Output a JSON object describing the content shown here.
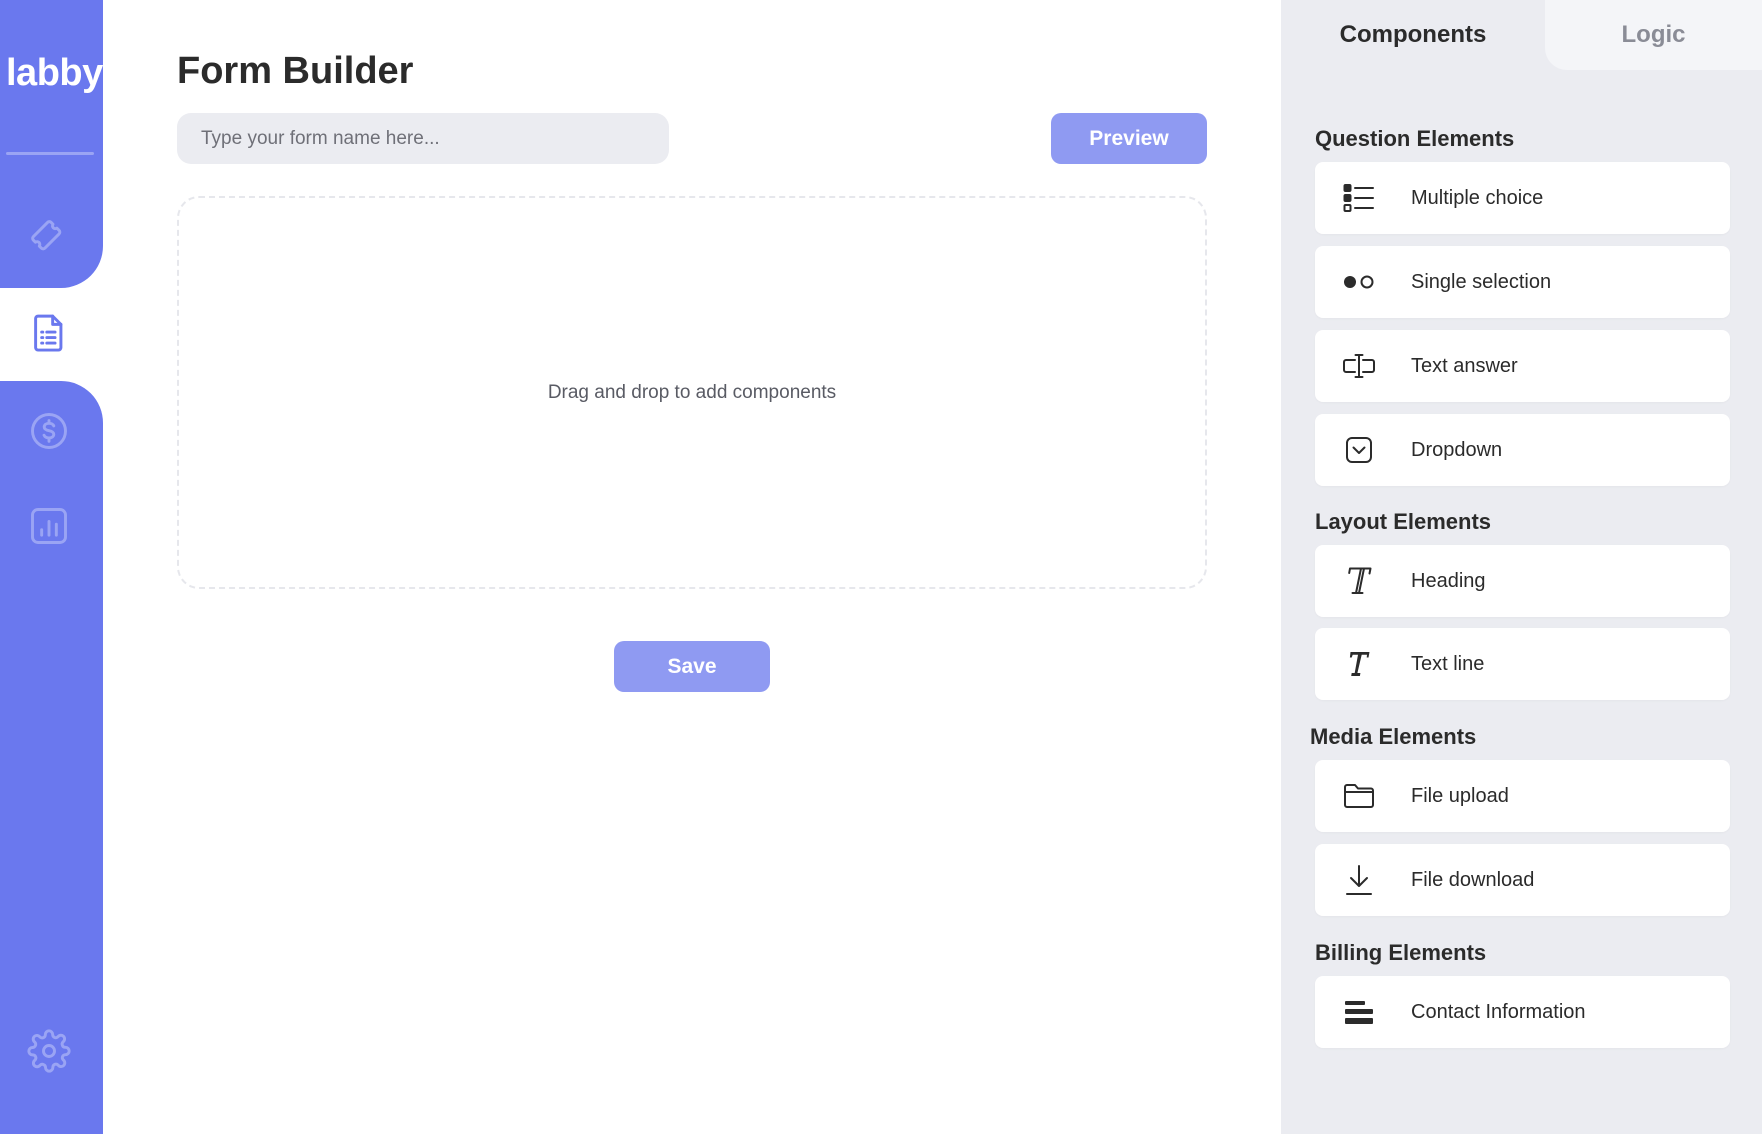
{
  "brand": {
    "logo_text": "labby",
    "accent": "#6a78ee",
    "button": "#8f9af2"
  },
  "sidebar": {
    "items": [
      {
        "name": "tag-icon",
        "active": false
      },
      {
        "name": "forms-icon",
        "active": true
      },
      {
        "name": "billing-icon",
        "active": false
      },
      {
        "name": "analytics-icon",
        "active": false
      },
      {
        "name": "settings-icon",
        "active": false
      }
    ]
  },
  "main": {
    "title": "Form Builder",
    "form_name_placeholder": "Type your form name here...",
    "form_name_value": "",
    "preview_label": "Preview",
    "drop_hint": "Drag and drop to add components",
    "save_label": "Save"
  },
  "panel": {
    "tabs": [
      {
        "label": "Components",
        "active": true
      },
      {
        "label": "Logic",
        "active": false
      }
    ],
    "sections": [
      {
        "title": "Question Elements",
        "items": [
          {
            "label": "Multiple choice",
            "icon": "list-icon"
          },
          {
            "label": "Single selection",
            "icon": "radio-icon"
          },
          {
            "label": "Text answer",
            "icon": "text-cursor-icon"
          },
          {
            "label": "Dropdown",
            "icon": "dropdown-icon"
          }
        ]
      },
      {
        "title": "Layout Elements",
        "items": [
          {
            "label": "Heading",
            "icon": "heading-icon"
          },
          {
            "label": "Text line",
            "icon": "text-icon"
          }
        ]
      },
      {
        "title": "Media Elements",
        "items": [
          {
            "label": "File upload",
            "icon": "folder-icon"
          },
          {
            "label": "File download",
            "icon": "download-icon"
          }
        ]
      },
      {
        "title": "Billing Elements",
        "items": [
          {
            "label": "Contact Information",
            "icon": "contact-icon"
          }
        ]
      }
    ]
  }
}
